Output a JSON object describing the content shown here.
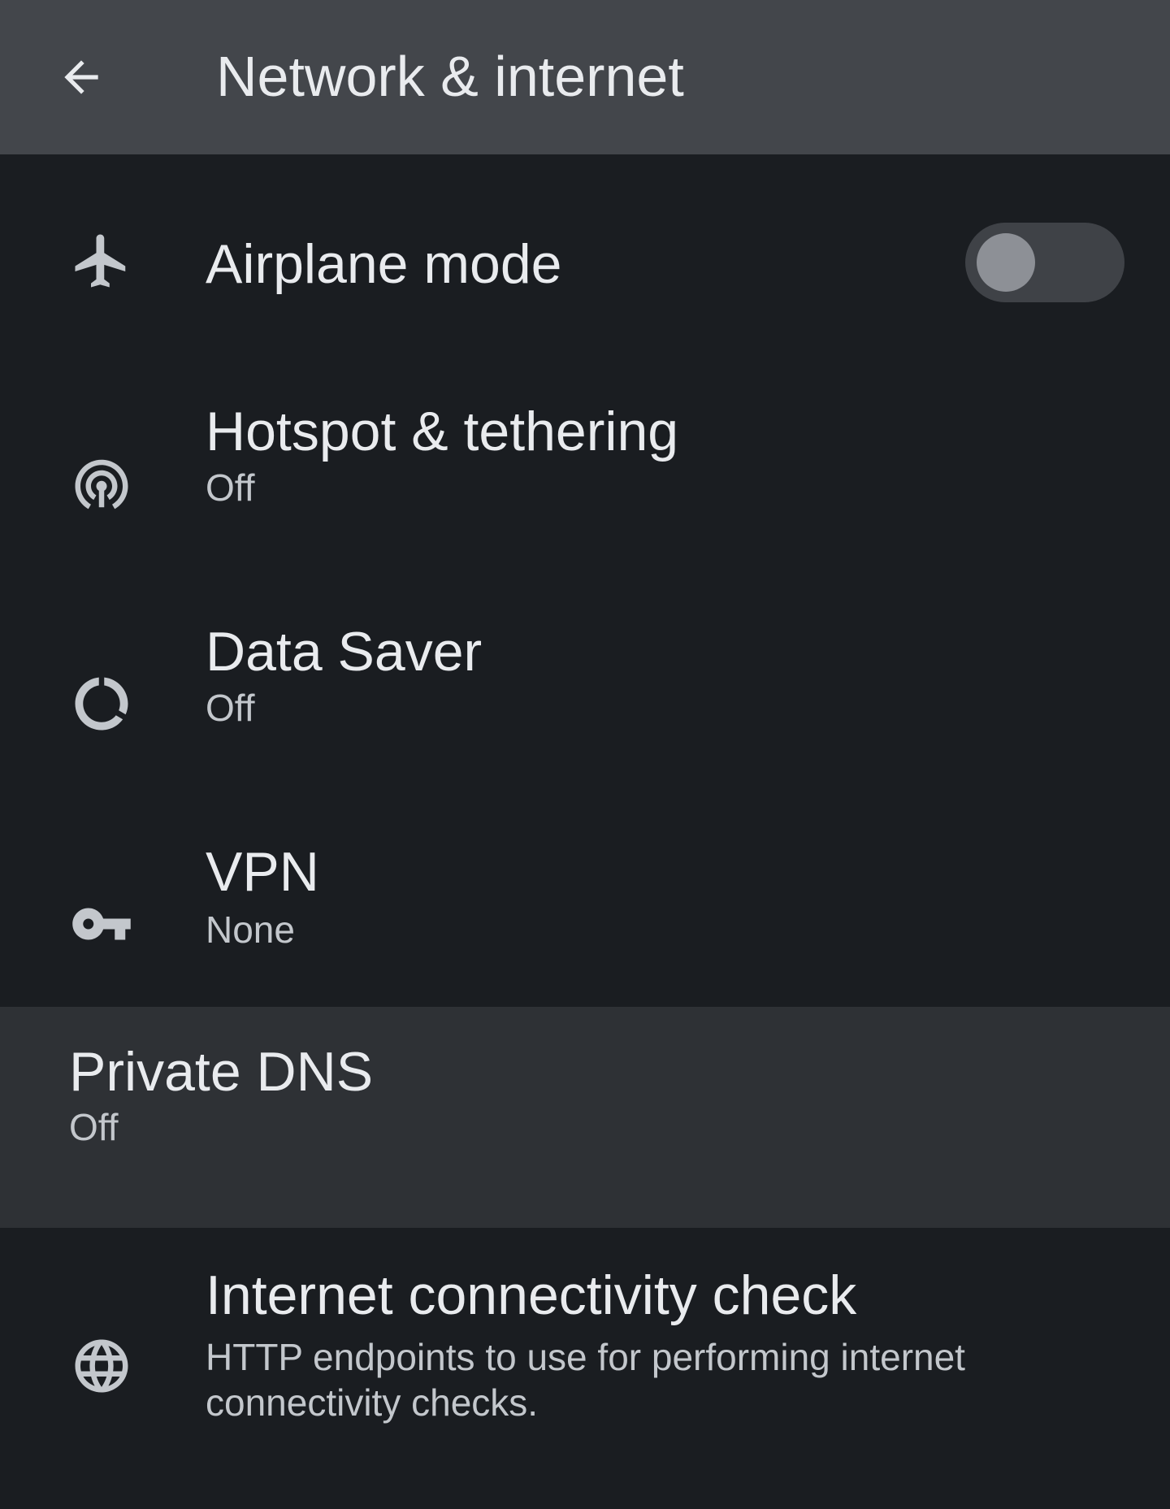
{
  "header": {
    "title": "Network & internet",
    "back_icon": "arrow-back-icon"
  },
  "items": [
    {
      "title": "Airplane mode",
      "summary": "",
      "icon": "airplane-icon",
      "toggle": {
        "on": false
      }
    },
    {
      "title": "Hotspot & tethering",
      "summary": "Off",
      "icon": "hotspot-icon"
    },
    {
      "title": "Data Saver",
      "summary": "Off",
      "icon": "data-saver-icon"
    },
    {
      "title": "VPN",
      "summary": "None",
      "icon": "vpn-key-icon"
    },
    {
      "title": "Private DNS",
      "summary": "Off",
      "icon": ""
    },
    {
      "title": "Internet connectivity check",
      "summary": "HTTP endpoints to use for performing internet connectivity checks.",
      "icon": "globe-icon"
    }
  ],
  "colors": {
    "appbar": "#43464b",
    "background": "#1a1d21",
    "highlight_row": "#2e3135",
    "text_primary": "#e9ebee",
    "text_secondary": "#c3c7cc"
  }
}
